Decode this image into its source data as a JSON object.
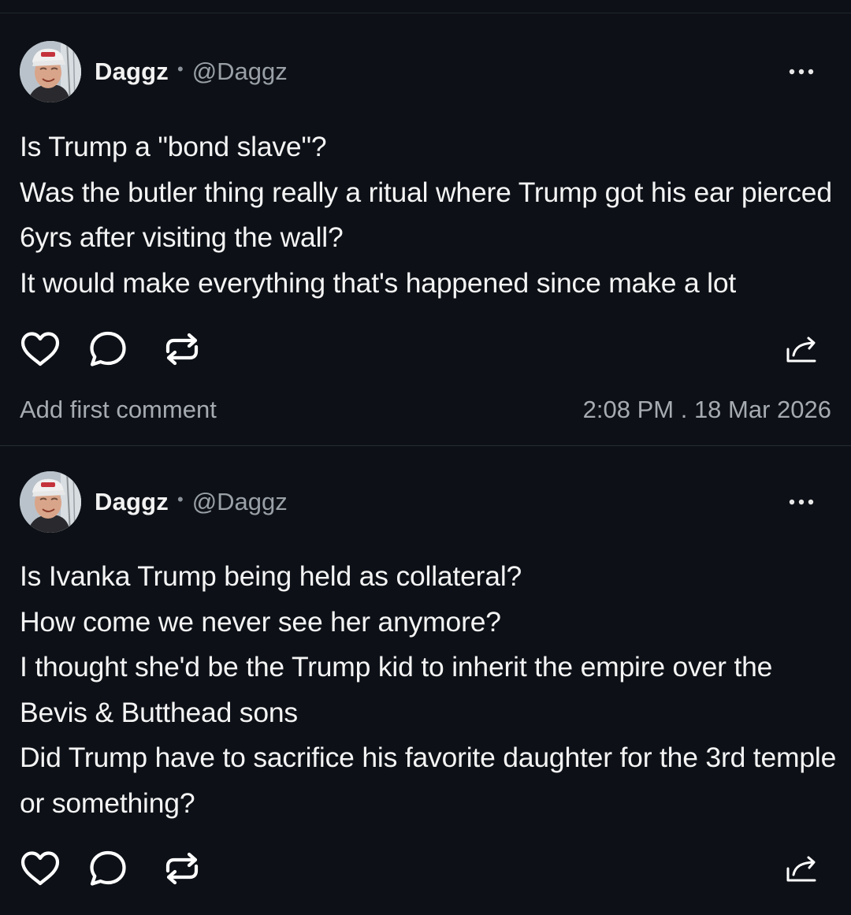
{
  "posts": [
    {
      "author": {
        "name": "Daggz",
        "separator": "•",
        "handle": "@Daggz"
      },
      "text": "Is Trump a \"bond slave\"?\nWas the butler thing really a ritual where Trump got his ear pierced 6yrs after visiting the wall?\nIt would make everything that's happened since make a lot",
      "add_comment_label": "Add first comment",
      "timestamp": "2:08 PM . 18 Mar 2026"
    },
    {
      "author": {
        "name": "Daggz",
        "separator": "•",
        "handle": "@Daggz"
      },
      "text": "Is Ivanka Trump being held as collateral?\nHow come we never see her anymore?\nI thought she'd be the Trump kid to inherit the empire over the Bevis & Butthead sons\nDid Trump have to sacrifice his favorite daughter for the 3rd temple or something?"
    }
  ],
  "icons": {
    "more": "more-horizontal-icon",
    "like": "heart-icon",
    "comment": "comment-bubble-icon",
    "repost": "repost-icon",
    "share": "share-icon"
  },
  "colors": {
    "background": "#0d1117",
    "text": "#f4f4f4",
    "muted": "#a6abb1",
    "divider": "#262c34"
  }
}
